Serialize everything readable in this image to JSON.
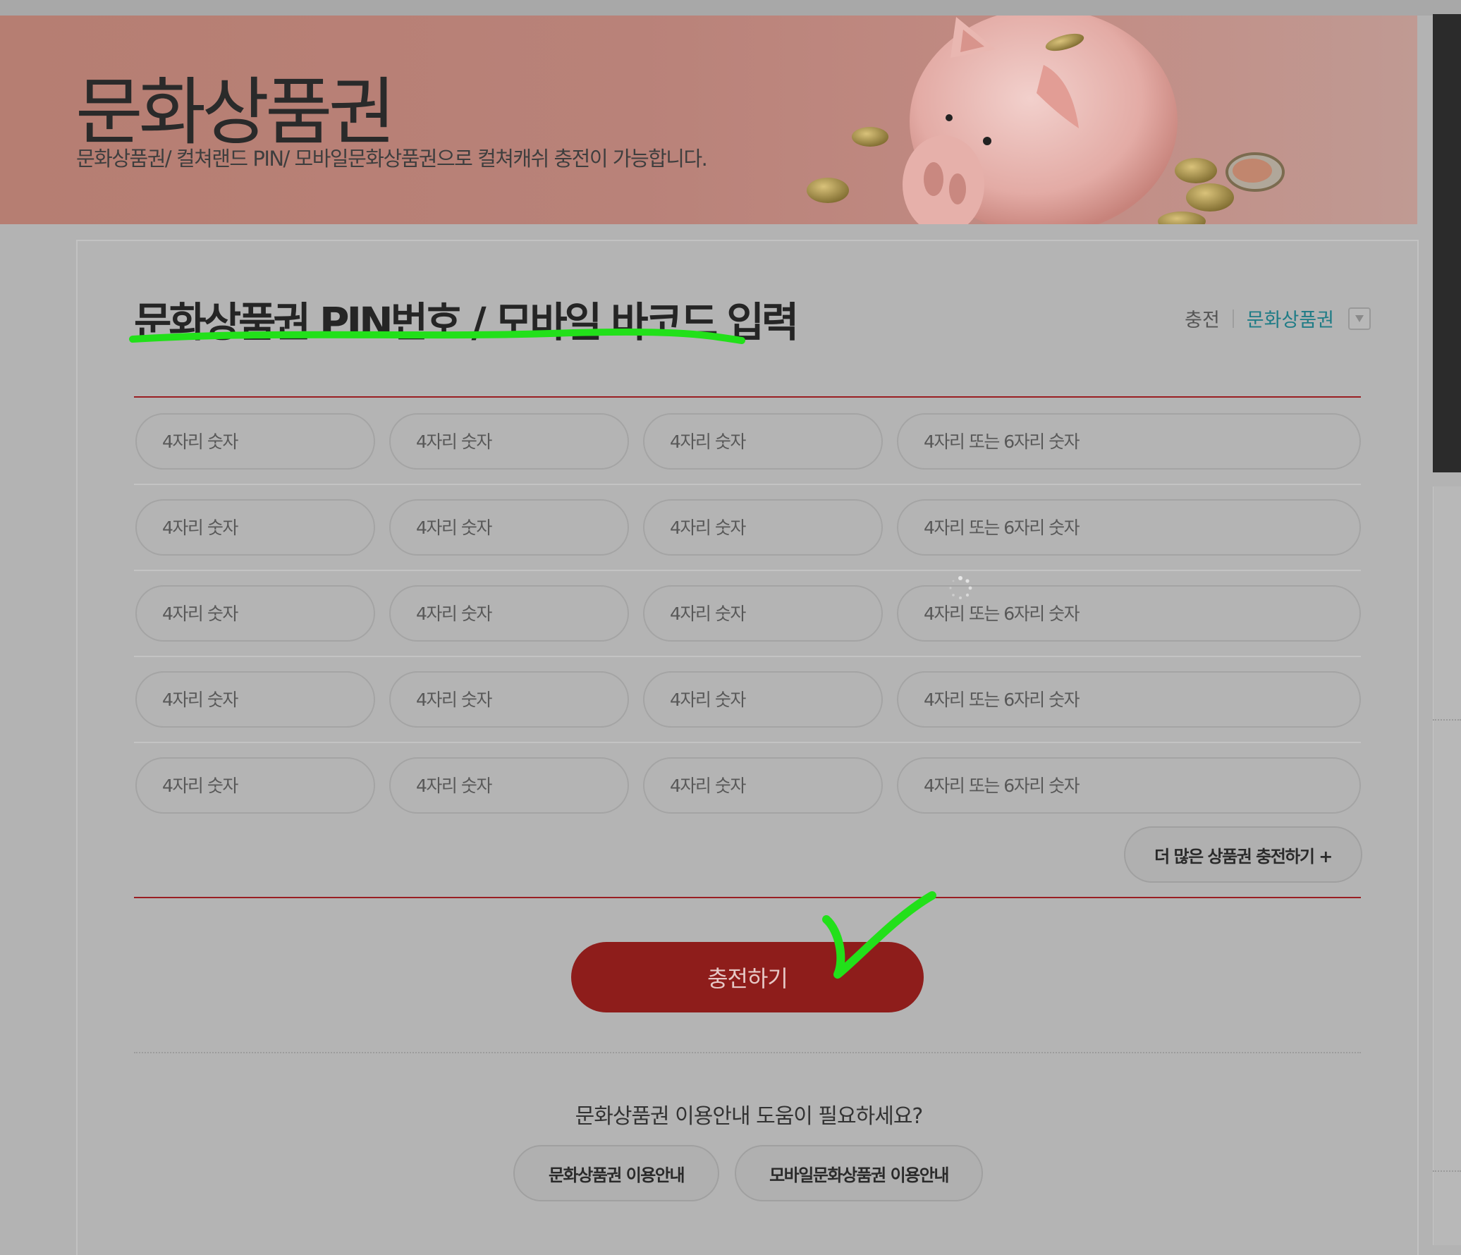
{
  "banner": {
    "title": "문화상품권",
    "subtitle": "문화상품권/ 컬쳐랜드 PIN/ 모바일문화상품권으로 컬쳐캐쉬 충전이 가능합니다."
  },
  "section": {
    "title": "문화상품권 PIN번호 / 모바일 바코드 입력",
    "breadcrumb": {
      "home": "충전",
      "current": "문화상품권",
      "toggle_icon": "triangle-down-icon"
    }
  },
  "pin_rows": [
    {
      "p1": "4자리 숫자",
      "p2": "4자리 숫자",
      "p3": "4자리 숫자",
      "p4": "4자리 또는 6자리 숫자"
    },
    {
      "p1": "4자리 숫자",
      "p2": "4자리 숫자",
      "p3": "4자리 숫자",
      "p4": "4자리 또는 6자리 숫자"
    },
    {
      "p1": "4자리 숫자",
      "p2": "4자리 숫자",
      "p3": "4자리 숫자",
      "p4": "4자리 또는 6자리 숫자"
    },
    {
      "p1": "4자리 숫자",
      "p2": "4자리 숫자",
      "p3": "4자리 숫자",
      "p4": "4자리 또는 6자리 숫자"
    },
    {
      "p1": "4자리 숫자",
      "p2": "4자리 숫자",
      "p3": "4자리 숫자",
      "p4": "4자리 또는 6자리 숫자"
    }
  ],
  "more_button": "더 많은 상품권 충전하기 +",
  "charge_button": "충전하기",
  "help": {
    "question": "문화상품권 이용안내 도움이 필요하세요?",
    "guide_button": "문화상품권 이용안내",
    "mobile_guide_button": "모바일문화상품권 이용안내"
  },
  "colors": {
    "accent_red": "#8e1d1b",
    "divider_red": "#9a1e22",
    "link_teal": "#1f7c86",
    "annotation_green": "#22e01a"
  }
}
